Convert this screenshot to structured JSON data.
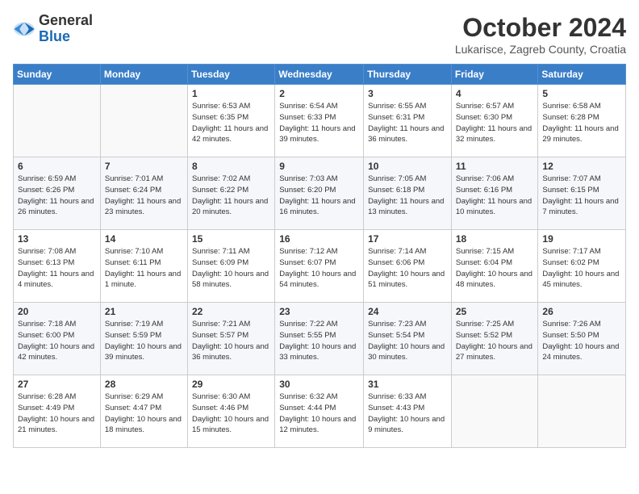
{
  "logo": {
    "general": "General",
    "blue": "Blue"
  },
  "title": {
    "month": "October 2024",
    "location": "Lukarisce, Zagreb County, Croatia"
  },
  "headers": [
    "Sunday",
    "Monday",
    "Tuesday",
    "Wednesday",
    "Thursday",
    "Friday",
    "Saturday"
  ],
  "weeks": [
    [
      {
        "day": "",
        "sunrise": "",
        "sunset": "",
        "daylight": ""
      },
      {
        "day": "",
        "sunrise": "",
        "sunset": "",
        "daylight": ""
      },
      {
        "day": "1",
        "sunrise": "Sunrise: 6:53 AM",
        "sunset": "Sunset: 6:35 PM",
        "daylight": "Daylight: 11 hours and 42 minutes."
      },
      {
        "day": "2",
        "sunrise": "Sunrise: 6:54 AM",
        "sunset": "Sunset: 6:33 PM",
        "daylight": "Daylight: 11 hours and 39 minutes."
      },
      {
        "day": "3",
        "sunrise": "Sunrise: 6:55 AM",
        "sunset": "Sunset: 6:31 PM",
        "daylight": "Daylight: 11 hours and 36 minutes."
      },
      {
        "day": "4",
        "sunrise": "Sunrise: 6:57 AM",
        "sunset": "Sunset: 6:30 PM",
        "daylight": "Daylight: 11 hours and 32 minutes."
      },
      {
        "day": "5",
        "sunrise": "Sunrise: 6:58 AM",
        "sunset": "Sunset: 6:28 PM",
        "daylight": "Daylight: 11 hours and 29 minutes."
      }
    ],
    [
      {
        "day": "6",
        "sunrise": "Sunrise: 6:59 AM",
        "sunset": "Sunset: 6:26 PM",
        "daylight": "Daylight: 11 hours and 26 minutes."
      },
      {
        "day": "7",
        "sunrise": "Sunrise: 7:01 AM",
        "sunset": "Sunset: 6:24 PM",
        "daylight": "Daylight: 11 hours and 23 minutes."
      },
      {
        "day": "8",
        "sunrise": "Sunrise: 7:02 AM",
        "sunset": "Sunset: 6:22 PM",
        "daylight": "Daylight: 11 hours and 20 minutes."
      },
      {
        "day": "9",
        "sunrise": "Sunrise: 7:03 AM",
        "sunset": "Sunset: 6:20 PM",
        "daylight": "Daylight: 11 hours and 16 minutes."
      },
      {
        "day": "10",
        "sunrise": "Sunrise: 7:05 AM",
        "sunset": "Sunset: 6:18 PM",
        "daylight": "Daylight: 11 hours and 13 minutes."
      },
      {
        "day": "11",
        "sunrise": "Sunrise: 7:06 AM",
        "sunset": "Sunset: 6:16 PM",
        "daylight": "Daylight: 11 hours and 10 minutes."
      },
      {
        "day": "12",
        "sunrise": "Sunrise: 7:07 AM",
        "sunset": "Sunset: 6:15 PM",
        "daylight": "Daylight: 11 hours and 7 minutes."
      }
    ],
    [
      {
        "day": "13",
        "sunrise": "Sunrise: 7:08 AM",
        "sunset": "Sunset: 6:13 PM",
        "daylight": "Daylight: 11 hours and 4 minutes."
      },
      {
        "day": "14",
        "sunrise": "Sunrise: 7:10 AM",
        "sunset": "Sunset: 6:11 PM",
        "daylight": "Daylight: 11 hours and 1 minute."
      },
      {
        "day": "15",
        "sunrise": "Sunrise: 7:11 AM",
        "sunset": "Sunset: 6:09 PM",
        "daylight": "Daylight: 10 hours and 58 minutes."
      },
      {
        "day": "16",
        "sunrise": "Sunrise: 7:12 AM",
        "sunset": "Sunset: 6:07 PM",
        "daylight": "Daylight: 10 hours and 54 minutes."
      },
      {
        "day": "17",
        "sunrise": "Sunrise: 7:14 AM",
        "sunset": "Sunset: 6:06 PM",
        "daylight": "Daylight: 10 hours and 51 minutes."
      },
      {
        "day": "18",
        "sunrise": "Sunrise: 7:15 AM",
        "sunset": "Sunset: 6:04 PM",
        "daylight": "Daylight: 10 hours and 48 minutes."
      },
      {
        "day": "19",
        "sunrise": "Sunrise: 7:17 AM",
        "sunset": "Sunset: 6:02 PM",
        "daylight": "Daylight: 10 hours and 45 minutes."
      }
    ],
    [
      {
        "day": "20",
        "sunrise": "Sunrise: 7:18 AM",
        "sunset": "Sunset: 6:00 PM",
        "daylight": "Daylight: 10 hours and 42 minutes."
      },
      {
        "day": "21",
        "sunrise": "Sunrise: 7:19 AM",
        "sunset": "Sunset: 5:59 PM",
        "daylight": "Daylight: 10 hours and 39 minutes."
      },
      {
        "day": "22",
        "sunrise": "Sunrise: 7:21 AM",
        "sunset": "Sunset: 5:57 PM",
        "daylight": "Daylight: 10 hours and 36 minutes."
      },
      {
        "day": "23",
        "sunrise": "Sunrise: 7:22 AM",
        "sunset": "Sunset: 5:55 PM",
        "daylight": "Daylight: 10 hours and 33 minutes."
      },
      {
        "day": "24",
        "sunrise": "Sunrise: 7:23 AM",
        "sunset": "Sunset: 5:54 PM",
        "daylight": "Daylight: 10 hours and 30 minutes."
      },
      {
        "day": "25",
        "sunrise": "Sunrise: 7:25 AM",
        "sunset": "Sunset: 5:52 PM",
        "daylight": "Daylight: 10 hours and 27 minutes."
      },
      {
        "day": "26",
        "sunrise": "Sunrise: 7:26 AM",
        "sunset": "Sunset: 5:50 PM",
        "daylight": "Daylight: 10 hours and 24 minutes."
      }
    ],
    [
      {
        "day": "27",
        "sunrise": "Sunrise: 6:28 AM",
        "sunset": "Sunset: 4:49 PM",
        "daylight": "Daylight: 10 hours and 21 minutes."
      },
      {
        "day": "28",
        "sunrise": "Sunrise: 6:29 AM",
        "sunset": "Sunset: 4:47 PM",
        "daylight": "Daylight: 10 hours and 18 minutes."
      },
      {
        "day": "29",
        "sunrise": "Sunrise: 6:30 AM",
        "sunset": "Sunset: 4:46 PM",
        "daylight": "Daylight: 10 hours and 15 minutes."
      },
      {
        "day": "30",
        "sunrise": "Sunrise: 6:32 AM",
        "sunset": "Sunset: 4:44 PM",
        "daylight": "Daylight: 10 hours and 12 minutes."
      },
      {
        "day": "31",
        "sunrise": "Sunrise: 6:33 AM",
        "sunset": "Sunset: 4:43 PM",
        "daylight": "Daylight: 10 hours and 9 minutes."
      },
      {
        "day": "",
        "sunrise": "",
        "sunset": "",
        "daylight": ""
      },
      {
        "day": "",
        "sunrise": "",
        "sunset": "",
        "daylight": ""
      }
    ]
  ]
}
